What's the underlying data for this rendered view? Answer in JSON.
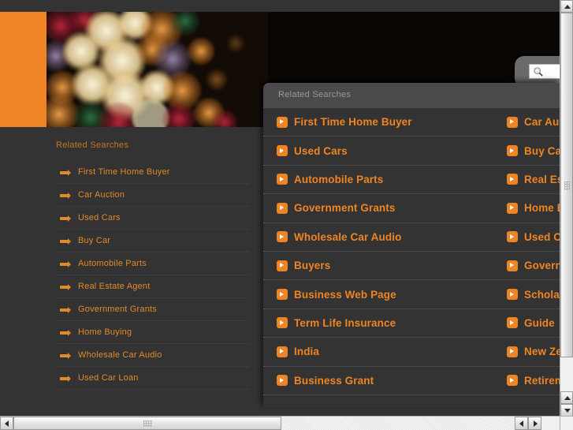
{
  "colors": {
    "accent_orange": "#ef8424",
    "link_orange": "#e08a28",
    "page_background": "#333333",
    "panel_background": "#333333",
    "panel_header": "#4a4a4a",
    "panel_header_text": "#9a9a9a"
  },
  "banner": {
    "name": "bokeh-lights-banner",
    "orange_block": "orange-color-block"
  },
  "search": {
    "icon": "search-icon",
    "value": "",
    "placeholder": ""
  },
  "sidebar": {
    "title": "Related Searches",
    "items": [
      {
        "label": "First Time Home Buyer",
        "icon": "arrow-bullet-icon"
      },
      {
        "label": "Car Auction",
        "icon": "arrow-bullet-icon"
      },
      {
        "label": "Used Cars",
        "icon": "arrow-bullet-icon"
      },
      {
        "label": "Buy Car",
        "icon": "arrow-bullet-icon"
      },
      {
        "label": "Automobile Parts",
        "icon": "arrow-bullet-icon"
      },
      {
        "label": "Real Estate Agent",
        "icon": "arrow-bullet-icon"
      },
      {
        "label": "Government Grants",
        "icon": "arrow-bullet-icon"
      },
      {
        "label": "Home Buying",
        "icon": "arrow-bullet-icon"
      },
      {
        "label": "Wholesale Car Audio",
        "icon": "arrow-bullet-icon"
      },
      {
        "label": "Used Car Loan",
        "icon": "arrow-bullet-icon"
      }
    ]
  },
  "overlay": {
    "title": "Related Searches",
    "icon": "chevron-right-icon",
    "rows": [
      {
        "left": "First Time Home Buyer",
        "right": "Car Au"
      },
      {
        "left": "Used Cars",
        "right": "Buy Ca"
      },
      {
        "left": "Automobile Parts",
        "right": "Real Es"
      },
      {
        "left": "Government Grants",
        "right": "Home B"
      },
      {
        "left": "Wholesale Car Audio",
        "right": "Used C"
      },
      {
        "left": "Buyers",
        "right": "Govern"
      },
      {
        "left": "Business Web Page",
        "right": "Schola"
      },
      {
        "left": "Term Life Insurance",
        "right": "Guide"
      },
      {
        "left": "India",
        "right": "New Ze"
      },
      {
        "left": "Business Grant",
        "right": "Retirem"
      }
    ]
  },
  "scrollbars": {
    "vertical": {
      "up_arrow": "scroll-up-icon",
      "up_arrow_2": "scroll-up-icon",
      "down_arrow": "scroll-down-icon"
    },
    "horizontal": {
      "left_arrow": "scroll-left-icon",
      "left_arrow_2": "scroll-left-icon",
      "right_arrow": "scroll-right-icon"
    }
  }
}
